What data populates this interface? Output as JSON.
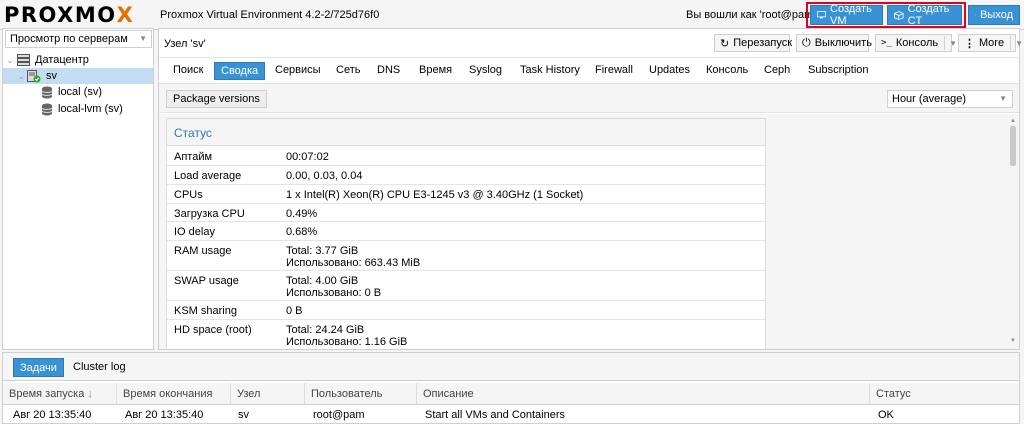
{
  "header": {
    "logo": "PROXMOX",
    "version": "Proxmox Virtual Environment 4.2-2/725d76f0",
    "user_label": "Вы вошли как 'root@pam'",
    "create_vm": "Создать VM",
    "create_ct": "Создать CT",
    "logout": "Выход"
  },
  "left": {
    "view_select": "Просмотр по серверам",
    "tree": [
      {
        "label": "Датацентр",
        "icon": "server-rack-icon"
      },
      {
        "label": "sv",
        "icon": "node-icon"
      },
      {
        "label": "local (sv)",
        "icon": "storage-icon"
      },
      {
        "label": "local-lvm (sv)",
        "icon": "storage-icon"
      }
    ]
  },
  "main": {
    "node_title": "Узел 'sv'",
    "toolbar": {
      "restart": "Перезапуск",
      "shutdown": "Выключить",
      "console": "Консоль",
      "more": "More"
    },
    "tabs": [
      "Поиск",
      "Сводка",
      "Сервисы",
      "Сеть",
      "DNS",
      "Время",
      "Syslog",
      "Task History",
      "Firewall",
      "Updates",
      "Консоль",
      "Ceph",
      "Subscription"
    ],
    "active_tab": "Сводка",
    "package_versions": "Package versions",
    "timeframe": "Hour (average)",
    "status": {
      "title": "Статус",
      "rows": [
        {
          "key": "Аптайм",
          "v1": "00:07:02",
          "v2": ""
        },
        {
          "key": "Load average",
          "v1": "0.00, 0.03, 0.04",
          "v2": ""
        },
        {
          "key": "CPUs",
          "v1": "1 x Intel(R) Xeon(R) CPU E3-1245 v3 @ 3.40GHz (1 Socket)",
          "v2": ""
        },
        {
          "key": "Загрузка CPU",
          "v1": "0.49%",
          "v2": ""
        },
        {
          "key": "IO delay",
          "v1": "0.68%",
          "v2": ""
        },
        {
          "key": "RAM usage",
          "v1": "Total: 3.77 GiB",
          "v2": "Использовано: 663.43 MiB"
        },
        {
          "key": "SWAP usage",
          "v1": "Total: 4.00 GiB",
          "v2": "Использовано: 0 B"
        },
        {
          "key": "KSM sharing",
          "v1": "0 B",
          "v2": ""
        },
        {
          "key": "HD space (root)",
          "v1": "Total: 24.24 GiB",
          "v2": "Использовано: 1.16 GiB"
        }
      ]
    }
  },
  "bottom": {
    "tabs": [
      "Задачи",
      "Cluster log"
    ],
    "columns": [
      "Время запуска",
      "Время окончания",
      "Узел",
      "Пользователь",
      "Описание",
      "Статус"
    ],
    "rows": [
      [
        "Авг 20 13:35:40",
        "Авг 20 13:35:40",
        "sv",
        "root@pam",
        "Start all VMs and Containers",
        "OK"
      ]
    ]
  },
  "colors": {
    "accent": "#3892d4",
    "highlight_box": "#e2001a",
    "logo_x": "#e57000",
    "selection": "#c2ddf2"
  }
}
